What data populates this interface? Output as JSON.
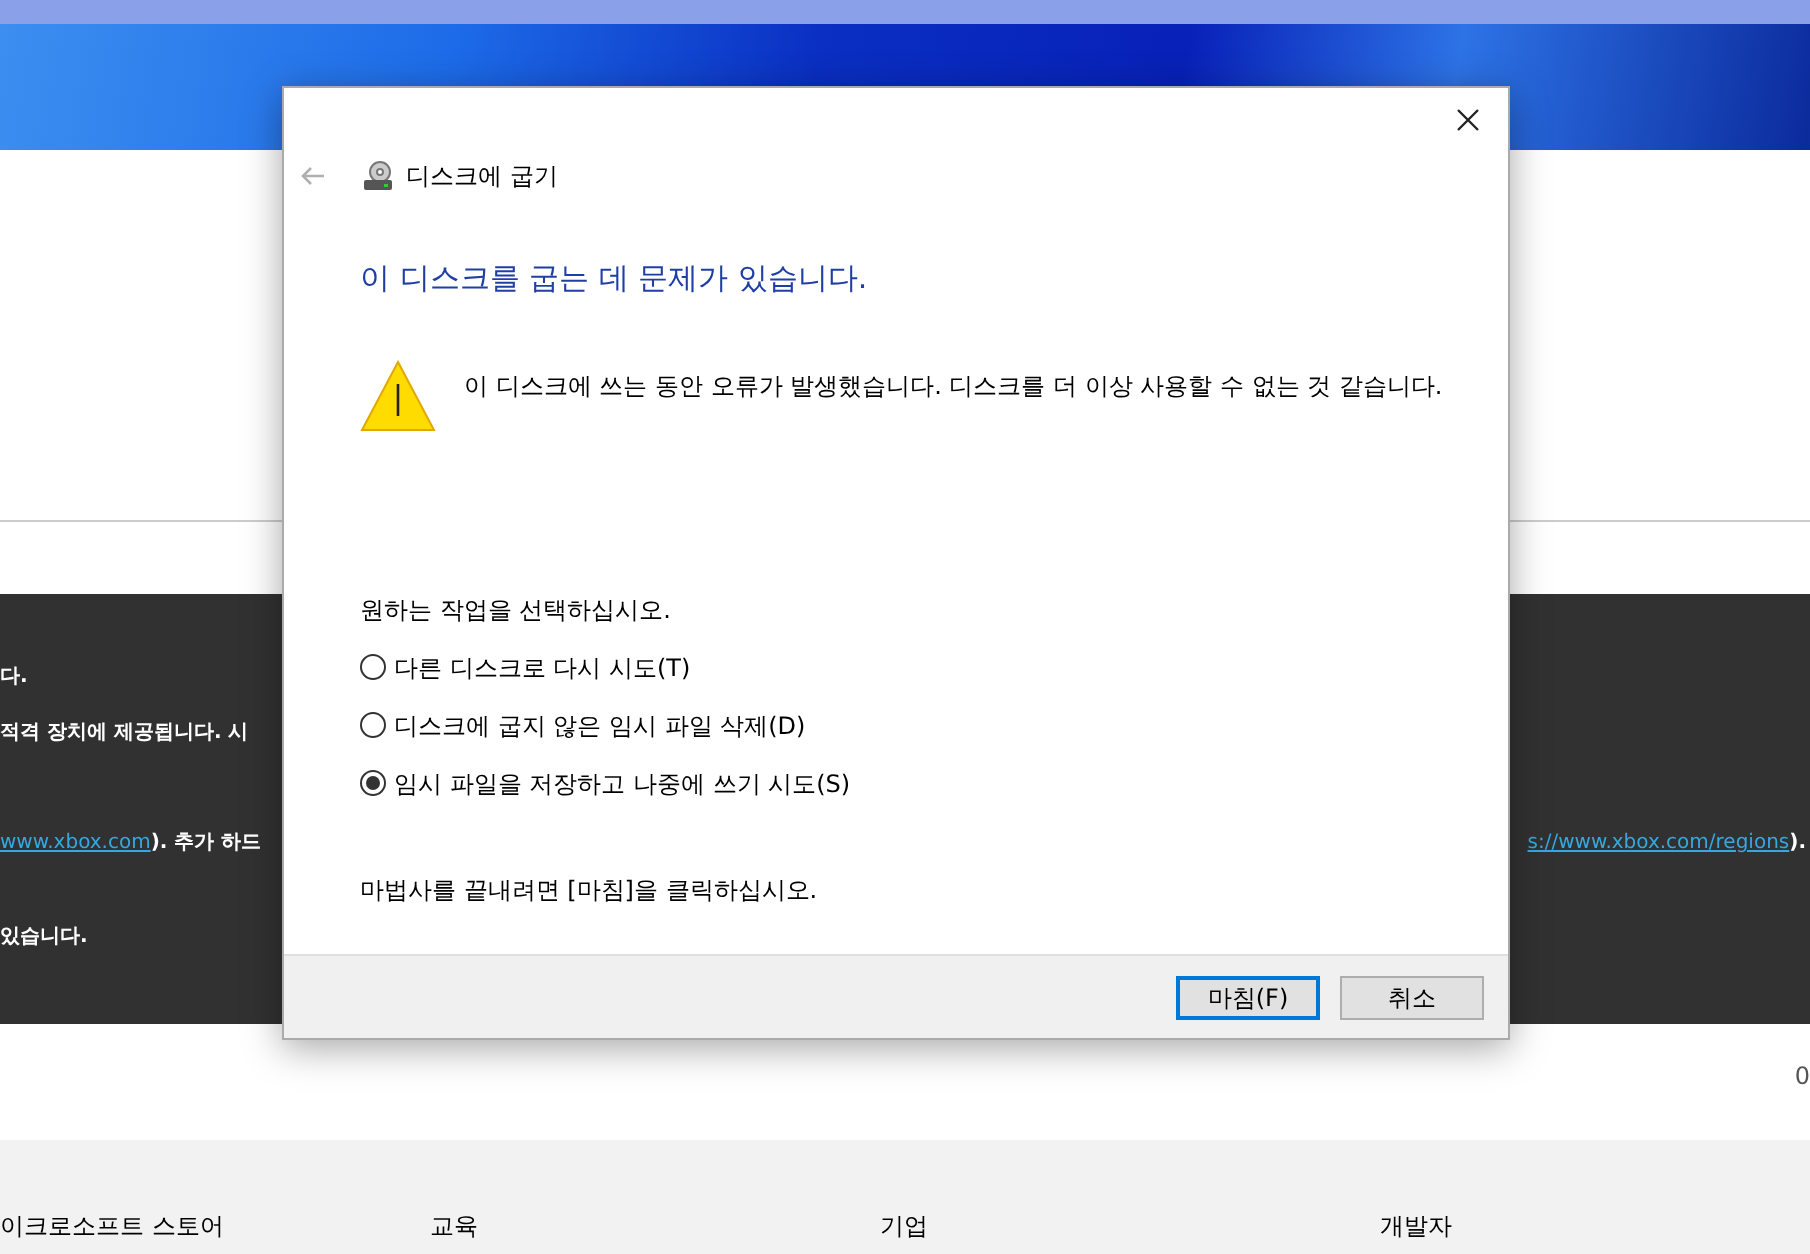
{
  "background_page": {
    "dark_band": {
      "rows": [
        {
          "left": [
            {
              "kind": "text",
              "text": "다."
            }
          ],
          "right": []
        },
        {
          "left": [
            {
              "kind": "text",
              "text": "적격 장치에 제공됩니다. 시"
            }
          ],
          "right": []
        },
        {
          "left": [
            {
              "kind": "link",
              "text": "www.xbox.com"
            },
            {
              "kind": "text",
              "text": "). 추가 하드"
            }
          ],
          "right": [
            {
              "kind": "link",
              "text": "s://www.xbox.com/regions"
            },
            {
              "kind": "text",
              "text": ")."
            }
          ]
        },
        {
          "left": [
            {
              "kind": "text",
              "text": "있습니다."
            }
          ],
          "right": []
        }
      ]
    },
    "side_text": "0",
    "footer_headings": [
      "이크로소프트 스토어",
      "교육",
      "기업",
      "개발자"
    ]
  },
  "dialog": {
    "back_button": {
      "disabled": true
    },
    "title": "디스크에 굽기",
    "heading": "이 디스크를 굽는 데 문제가 있습니다.",
    "message": "이 디스크에 쓰는 동안 오류가 발생했습니다. 디스크를 더 이상 사용할 수 없는 것 같습니다.",
    "prompt": "원하는 작업을 선택하십시오.",
    "options": [
      {
        "label": "다른 디스크로 다시 시도(T)",
        "selected": false
      },
      {
        "label": "디스크에 굽지 않은 임시 파일 삭제(D)",
        "selected": false
      },
      {
        "label": "임시 파일을 저장하고 나중에 쓰기 시도(S)",
        "selected": true
      }
    ],
    "finish_hint": "마법사를 끝내려면 [마침]을 클릭하십시오.",
    "buttons": [
      {
        "label": "마침(F)",
        "default": true
      },
      {
        "label": "취소",
        "default": false
      }
    ]
  }
}
